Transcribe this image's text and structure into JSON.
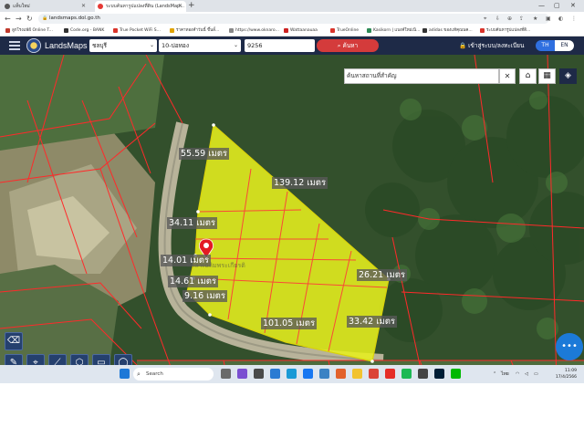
{
  "browser": {
    "tabs": [
      {
        "label": "แท็บใหม่",
        "active": false
      },
      {
        "label": "ระบบค้นหารูปแปลงที่ดิน (LandsMap...",
        "active": true
      }
    ],
    "url": "landsmaps.dol.go.th",
    "bookmarks": [
      {
        "label": "ลูกโรงแพ้ฝ์ Online T...",
        "color": "#c0392b"
      },
      {
        "label": "Code.org - BANK",
        "color": "#333333"
      },
      {
        "label": "True Pocket WiFi S...",
        "color": "#d9342b"
      },
      {
        "label": "ราคาทองคำวันนี้ ขึ้นลั้...",
        "color": "#e0a300"
      },
      {
        "label": "https://www.oknaro...",
        "color": "#888888"
      },
      {
        "label": "Wattaanauaa",
        "color": "#cc2222"
      },
      {
        "label": "TrueOnline",
        "color": "#d9342b"
      },
      {
        "label": "Kasikorn | แบงค์ใหม่เนิ...",
        "color": "#2e8b57"
      },
      {
        "label": "adidas ของแท้คุณนค...",
        "color": "#333333"
      },
      {
        "label": "ระบบค้นหารูปแปลงที่ดิ...",
        "color": "#d9342b"
      }
    ]
  },
  "app": {
    "brand": "LandsMaps",
    "province": "ชลบุรี",
    "district": "10-บ่อทอง",
    "parcel_no": "9256",
    "search_label": "ค้นหา",
    "login_label": "เข้าสู่ระบบ/ลงทะเบียน",
    "lang_th": "TH",
    "lang_en": "EN",
    "place_search_placeholder": "ค้นหาสถานที่สำคัญ",
    "place_name_faint": "ศาลาเฉลิมพระเกียรติ"
  },
  "measurements": [
    {
      "id": "m1",
      "text": "55.59 เมตร"
    },
    {
      "id": "m2",
      "text": "139.12 เมตร"
    },
    {
      "id": "m3",
      "text": "34.11 เมตร"
    },
    {
      "id": "m4",
      "text": "14.01 เมตร"
    },
    {
      "id": "m5",
      "text": "14.61 เมตร"
    },
    {
      "id": "m6",
      "text": "9.16 เมตร"
    },
    {
      "id": "m7",
      "text": "26.21 เมตร"
    },
    {
      "id": "m8",
      "text": "101.05 เมตร"
    },
    {
      "id": "m9",
      "text": "33.42 เมตร"
    }
  ],
  "taskbar": {
    "search_label": "Search",
    "lang_indicator": "ไทย",
    "time": "11:09",
    "date": "17/4/2566"
  },
  "colors": {
    "parcel_fill": "#e6ef1e",
    "boundary": "#ff2a2a",
    "header_bg": "#1e2a47",
    "search_btn": "#d43b3b"
  }
}
